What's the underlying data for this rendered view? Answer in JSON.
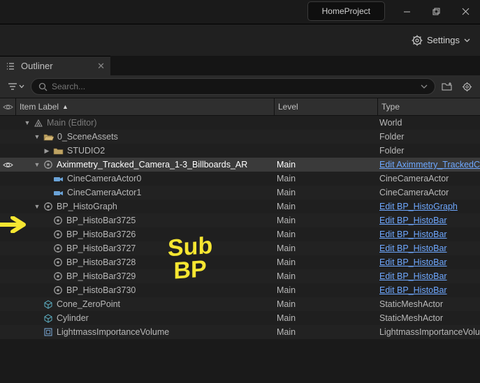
{
  "title": "HomeProject",
  "settings_label": "Settings",
  "tabs": {
    "outliner": "Outliner"
  },
  "search": {
    "placeholder": "Search..."
  },
  "headers": {
    "item": "Item Label",
    "level": "Level",
    "type": "Type"
  },
  "tree": [
    {
      "depth": 0,
      "arrow": "down",
      "icon": "world",
      "label": "Main (Editor)",
      "level": "",
      "type": "World",
      "link": false,
      "vis": false,
      "dim": true
    },
    {
      "depth": 1,
      "arrow": "down",
      "icon": "folder-open",
      "label": "0_SceneAssets",
      "level": "",
      "type": "Folder",
      "link": false,
      "vis": false
    },
    {
      "depth": 2,
      "arrow": "right",
      "icon": "folder",
      "label": "STUDIO2",
      "level": "",
      "type": "Folder",
      "link": false,
      "vis": false
    },
    {
      "depth": 1,
      "arrow": "down",
      "icon": "bp",
      "label": "Aximmetry_Tracked_Camera_1-3_Billboards_AR",
      "level": "Main",
      "type": "Edit Aximmetry_TrackedCamera",
      "link": true,
      "vis": true,
      "sel": true
    },
    {
      "depth": 2,
      "arrow": "",
      "icon": "camera",
      "label": "CineCameraActor0",
      "level": "Main",
      "type": "CineCameraActor",
      "link": false,
      "vis": false
    },
    {
      "depth": 2,
      "arrow": "",
      "icon": "camera",
      "label": "CineCameraActor1",
      "level": "Main",
      "type": "CineCameraActor",
      "link": false,
      "vis": false
    },
    {
      "depth": 1,
      "arrow": "down",
      "icon": "bp",
      "label": "BP_HistoGraph",
      "level": "Main",
      "type": "Edit BP_HistoGraph",
      "link": true,
      "vis": false
    },
    {
      "depth": 2,
      "arrow": "",
      "icon": "bp",
      "label": "BP_HistoBar3725",
      "level": "Main",
      "type": "Edit BP_HistoBar",
      "link": true,
      "vis": false
    },
    {
      "depth": 2,
      "arrow": "",
      "icon": "bp",
      "label": "BP_HistoBar3726",
      "level": "Main",
      "type": "Edit BP_HistoBar",
      "link": true,
      "vis": false
    },
    {
      "depth": 2,
      "arrow": "",
      "icon": "bp",
      "label": "BP_HistoBar3727",
      "level": "Main",
      "type": "Edit BP_HistoBar",
      "link": true,
      "vis": false
    },
    {
      "depth": 2,
      "arrow": "",
      "icon": "bp",
      "label": "BP_HistoBar3728",
      "level": "Main",
      "type": "Edit BP_HistoBar",
      "link": true,
      "vis": false
    },
    {
      "depth": 2,
      "arrow": "",
      "icon": "bp",
      "label": "BP_HistoBar3729",
      "level": "Main",
      "type": "Edit BP_HistoBar",
      "link": true,
      "vis": false
    },
    {
      "depth": 2,
      "arrow": "",
      "icon": "bp",
      "label": "BP_HistoBar3730",
      "level": "Main",
      "type": "Edit BP_HistoBar",
      "link": true,
      "vis": false
    },
    {
      "depth": 1,
      "arrow": "",
      "icon": "mesh",
      "label": "Cone_ZeroPoint",
      "level": "Main",
      "type": "StaticMeshActor",
      "link": false,
      "vis": false
    },
    {
      "depth": 1,
      "arrow": "",
      "icon": "mesh",
      "label": "Cylinder",
      "level": "Main",
      "type": "StaticMeshActor",
      "link": false,
      "vis": false
    },
    {
      "depth": 1,
      "arrow": "",
      "icon": "volume",
      "label": "LightmassImportanceVolume",
      "level": "Main",
      "type": "LightmassImportanceVolume",
      "link": false,
      "vis": false
    }
  ],
  "annot": {
    "sub1": "Sub",
    "sub2": "BP"
  }
}
